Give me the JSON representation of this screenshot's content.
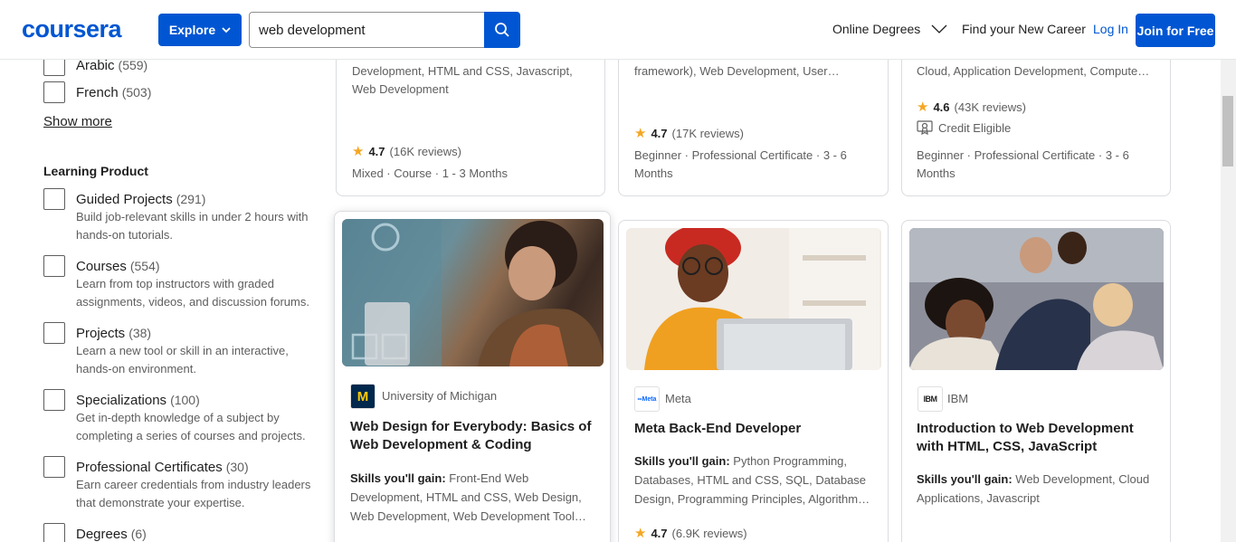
{
  "header": {
    "logo": "coursera",
    "explore_label": "Explore",
    "search_value": "web development",
    "nav_online_degrees": "Online Degrees",
    "nav_find_career": "Find your New Career",
    "login_label": "Log In",
    "join_label": "Join for Free"
  },
  "sidebar": {
    "languages": [
      {
        "label": "Arabic",
        "count": "(559)"
      },
      {
        "label": "French",
        "count": "(503)"
      }
    ],
    "show_more": "Show more",
    "learning_product_title": "Learning Product",
    "products": [
      {
        "label": "Guided Projects",
        "count": "(291)",
        "desc": "Build job-relevant skills in under 2 hours with hands-on tutorials."
      },
      {
        "label": "Courses",
        "count": "(554)",
        "desc": "Learn from top instructors with graded assignments, videos, and discussion forums."
      },
      {
        "label": "Projects",
        "count": "(38)",
        "desc": "Learn a new tool or skill in an interactive, hands-on environment."
      },
      {
        "label": "Specializations",
        "count": "(100)",
        "desc": "Get in-depth knowledge of a subject by completing a series of courses and projects."
      },
      {
        "label": "Professional Certificates",
        "count": "(30)",
        "desc": "Earn career credentials from industry leaders that demonstrate your expertise."
      },
      {
        "label": "Degrees",
        "count": "(6)",
        "desc": ""
      }
    ]
  },
  "top_cards": [
    {
      "skills_tail": "Development, HTML and CSS, Javascript, Web Development",
      "rating": "4.7",
      "reviews": "(16K reviews)",
      "meta": "Mixed · Course · 1 - 3 Months"
    },
    {
      "skills_tail": "framework), Web Development, User…",
      "rating": "4.7",
      "reviews": "(17K reviews)",
      "meta": "Beginner · Professional Certificate · 3 - 6 Months"
    },
    {
      "skills_tail": "Cloud, Application Development, Compute…",
      "rating": "4.6",
      "reviews": "(43K reviews)",
      "credit": "Credit Eligible",
      "meta": "Beginner · Professional Certificate · 3 - 6 Months"
    }
  ],
  "cards": [
    {
      "partner": "University of Michigan",
      "title": "Web Design for Everybody: Basics of Web Development & Coding",
      "skills_label": "Skills you'll gain:",
      "skills": "Front-End Web Development, HTML and CSS, Web Design, Web Development, Web Development Tool…"
    },
    {
      "partner": "Meta",
      "title": "Meta Back-End Developer",
      "skills_label": "Skills you'll gain:",
      "skills": "Python Programming, Databases, HTML and CSS, SQL, Database Design, Programming Principles, Algorithm…",
      "rating": "4.7",
      "reviews": "(6.9K reviews)"
    },
    {
      "partner": "IBM",
      "title": "Introduction to Web Development with HTML, CSS, JavaScript",
      "skills_label": "Skills you'll gain:",
      "skills": "Web Development, Cloud Applications, Javascript"
    }
  ],
  "colors": {
    "brand": "#0056d2",
    "star": "#f5a623"
  }
}
